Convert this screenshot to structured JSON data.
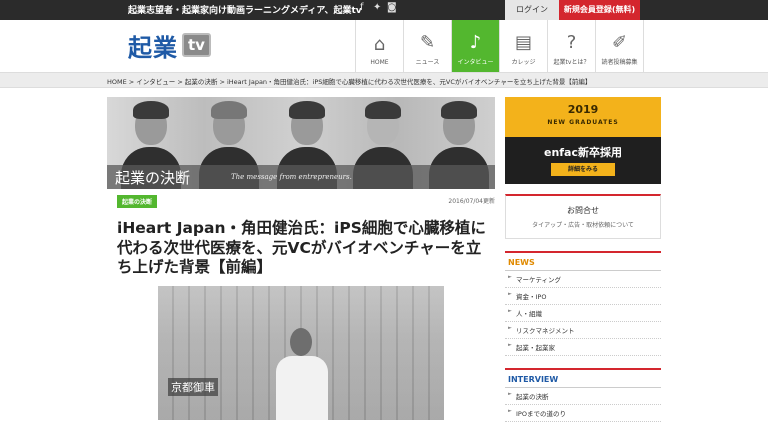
{
  "topbar": {
    "tagline": "起業志望者・起業家向け動画ラーニングメディア、起業tv",
    "social": [
      "f",
      "✦",
      "◙"
    ],
    "login": "ログイン",
    "signup": "新規会員登録(無料)"
  },
  "logo": {
    "text": "起業",
    "badge": "tv"
  },
  "nav": [
    {
      "label": "HOME",
      "icon": "home-icon"
    },
    {
      "label": "ニュース",
      "icon": "pin-icon"
    },
    {
      "label": "インタビュー",
      "icon": "mic-icon"
    },
    {
      "label": "カレッジ",
      "icon": "book-icon"
    },
    {
      "label": "起業tvとは？",
      "icon": "question-icon"
    },
    {
      "label": "読者投稿募集",
      "icon": "pen-icon"
    }
  ],
  "breadcrumb": "HOME > インタビュー > 起業の決断 > iHeart Japan・角田健治氏：iPS細胞で心臓移植に代わる次世代医療を、元VCがバイオベンチャーを立ち上げた背景【前編】",
  "banner": {
    "title": "起業の決断",
    "subtitle": "The message from entrepreneurs."
  },
  "article": {
    "category": "起業の決断",
    "date": "2016/07/04更新",
    "title": "iHeart Japan・角田健治氏：iPS細胞で心臓移植に代わる次世代医療を、元VCがバイオベンチャーを立ち上げた背景【前編】",
    "photo_sign": "京都御車"
  },
  "sidebar": {
    "ad": {
      "year": "2019",
      "sub": "NEW GRADUATES",
      "company": "enfac新卒採用",
      "button": "詳細をみる"
    },
    "contact": {
      "title": "お問合せ",
      "sub": "タイアップ・広告・取材依頼について"
    },
    "news": {
      "heading": "NEWS",
      "items": [
        "マーケティング",
        "資金・IPO",
        "人・組織",
        "リスクマネジメント",
        "起業・起業家"
      ]
    },
    "interview": {
      "heading": "INTERVIEW",
      "items": [
        "起業の決断",
        "IPOまでの道のり"
      ]
    }
  }
}
